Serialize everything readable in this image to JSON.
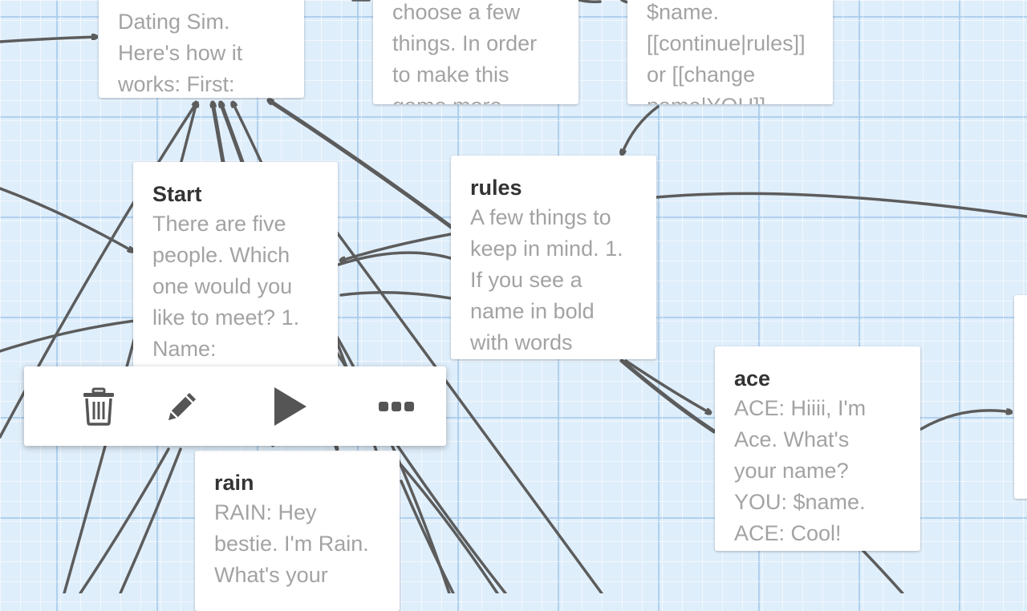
{
  "passages": {
    "intro": {
      "excerpt": "Dating Sim.\nHere's how it\nworks: First:"
    },
    "choose": {
      "excerpt": "choose a few\nthings. In order\nto make this\ngame more"
    },
    "name": {
      "excerpt": "$name.\n[[continue|rules]]\nor [[change\nname|YOU]]"
    },
    "start": {
      "title": "Start",
      "excerpt": "There are five\npeople. Which\none would you\nlike to meet? 1.\nName:"
    },
    "rules": {
      "title": "rules",
      "excerpt": "A few things to\nkeep in mind. 1.\nIf you see a\nname in bold\nwith words"
    },
    "ace": {
      "title": "ace",
      "excerpt": "ACE: Hiiii, I'm\nAce. What's\nyour name?\nYOU: $name.\nACE: Cool!"
    },
    "rain": {
      "title": "rain",
      "excerpt": "RAIN: Hey\nbestie. I'm Rain.\nWhat's your"
    }
  },
  "toolbar": {
    "buttons": [
      {
        "icon": "trash-icon",
        "action": "delete"
      },
      {
        "icon": "pencil-icon",
        "action": "edit"
      },
      {
        "icon": "play-icon",
        "action": "test-from-here"
      },
      {
        "icon": "more-icon",
        "action": "more"
      }
    ]
  },
  "colors": {
    "canvas": "#dfeefb",
    "arrow": "#5c5c5c",
    "title": "#333333",
    "excerpt": "#a3a3a3",
    "card": "#ffffff"
  }
}
